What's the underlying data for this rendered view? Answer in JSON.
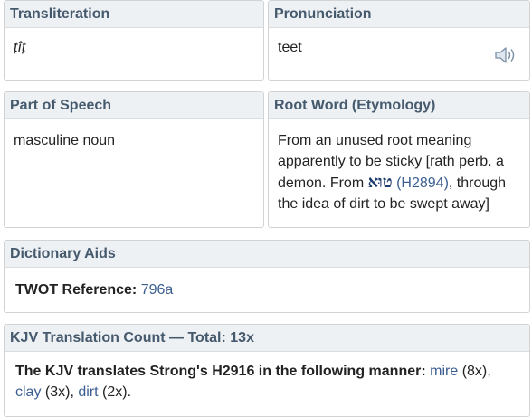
{
  "transliteration": {
    "heading": "Transliteration",
    "value": "ṭîṭ"
  },
  "pronunciation": {
    "heading": "Pronunciation",
    "value": "teet",
    "audio_icon": "speaker-icon"
  },
  "part_of_speech": {
    "heading": "Part of Speech",
    "value": "masculine noun"
  },
  "root_word": {
    "heading": "Root Word (Etymology)",
    "text_before": "From an unused root meaning apparently to be sticky [rath perb. a demon. From ",
    "hebrew": "טוּא",
    "ref_link": "(H2894)",
    "text_after": ", through the idea of dirt to be swept away]"
  },
  "dictionary_aids": {
    "heading": "Dictionary Aids",
    "twot_label": "TWOT Reference:",
    "twot_link": "796a"
  },
  "kjv": {
    "heading": "KJV Translation Count — Total: 13x",
    "intro": "The KJV translates Strong's H2916 in the following manner:",
    "entries": [
      {
        "word": "mire",
        "count": "(8x)",
        "sep": ", "
      },
      {
        "word": "clay",
        "count": "(3x)",
        "sep": ", "
      },
      {
        "word": "dirt",
        "count": "(2x)",
        "sep": "."
      }
    ]
  }
}
